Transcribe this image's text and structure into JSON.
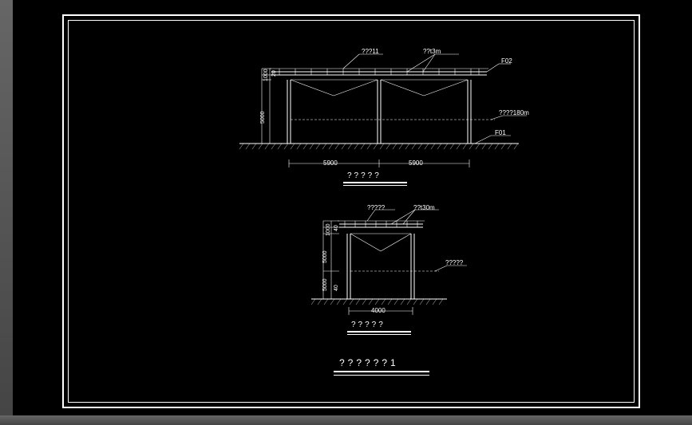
{
  "top": {
    "label_left": "???11",
    "label_right": "??t3m",
    "f02": "F02",
    "f01": "F01",
    "beam_label": "????180m",
    "dim_v_upper": "1000",
    "dim_v_upper2": "20",
    "dim_v_total": "5000",
    "span_left": "5900",
    "span_right": "5900",
    "title": "?????"
  },
  "bottom": {
    "label_top": "?????",
    "label_top_right": "??t30m",
    "right_label": "?????",
    "dim_v_upper": "1000",
    "dim_v_upper2": "40",
    "dim_v_mid": "5000",
    "dim_v_low": "5000",
    "dim_v_low2": "40",
    "span": "4000",
    "title": "?????"
  },
  "main_title": "??????1"
}
